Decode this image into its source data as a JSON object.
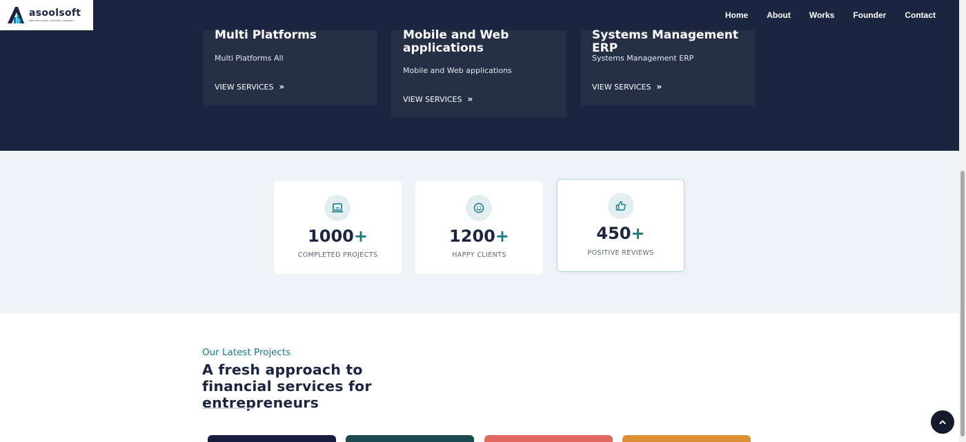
{
  "brand": {
    "name": "asoolsoft",
    "tagline": "WEB SOLUTIONS | HOSTING | GROWTH"
  },
  "nav": {
    "items": [
      {
        "label": "Home"
      },
      {
        "label": "About"
      },
      {
        "label": "Works"
      },
      {
        "label": "Founder"
      },
      {
        "label": "Contact"
      }
    ]
  },
  "services": [
    {
      "title": "Multi Platforms",
      "desc": "Multi Platforms All",
      "link": "VIEW SERVICES"
    },
    {
      "title": "Mobile and Web applications",
      "desc": "Mobile and Web applications",
      "link": "VIEW SERVICES"
    },
    {
      "title": "Systems Management ERP",
      "desc": "Systems Management ERP",
      "link": "VIEW SERVICES"
    }
  ],
  "stats": [
    {
      "number": "1000",
      "plus": "+",
      "label": "COMPLETED PROJECTS",
      "icon": "laptop-icon"
    },
    {
      "number": "1200",
      "plus": "+",
      "label": "HAPPY CLIENTS",
      "icon": "smile-icon"
    },
    {
      "number": "450",
      "plus": "+",
      "label": "POSITIVE REVIEWS",
      "icon": "thumbs-up-icon"
    }
  ],
  "projects": {
    "kicker": "Our Latest Projects",
    "title": "A fresh approach to financial services for entrepreneurs"
  },
  "colors": {
    "navy": "#1b2540",
    "card": "#253047",
    "teal": "#137a82",
    "project_cards": [
      "#161c3d",
      "#1d4a4f",
      "#e2695f",
      "#dc8f34"
    ]
  }
}
